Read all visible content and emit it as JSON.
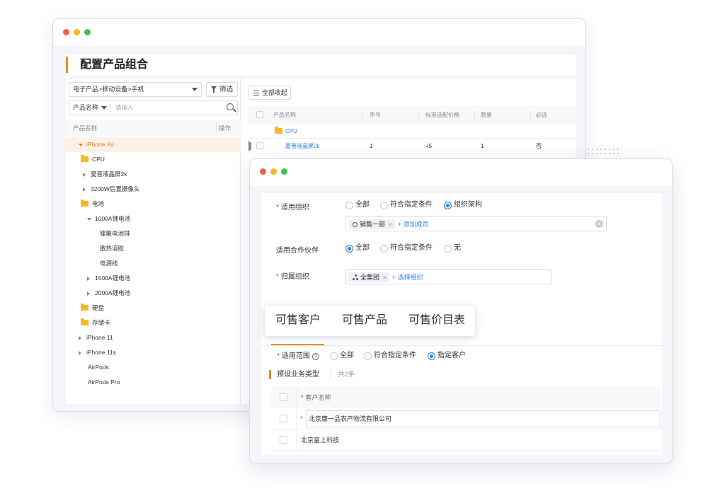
{
  "back_window": {
    "page_title": "配置产品组合",
    "category_select": "电子产品>移动设备>手机",
    "filter_button": "筛选",
    "search_field_label": "产品名称",
    "search_placeholder": "请输入",
    "tree_header": {
      "name": "产品名称",
      "action": "操作"
    },
    "tree_items": [
      {
        "label": "iPhone Xs",
        "level": 0,
        "kind": "arrow-down",
        "selected": true
      },
      {
        "label": "CPU",
        "level": 1,
        "kind": "folder"
      },
      {
        "label": "夏普液晶屏2k",
        "level": 1,
        "kind": "arrow-right"
      },
      {
        "label": "3200W后置摄像头",
        "level": 1,
        "kind": "arrow-right"
      },
      {
        "label": "电池",
        "level": 1,
        "kind": "folder"
      },
      {
        "label": "1000A锂电池",
        "level": 2,
        "kind": "arrow-down"
      },
      {
        "label": "镍聚电池排",
        "level": 3,
        "kind": "none"
      },
      {
        "label": "散热溶胶",
        "level": 3,
        "kind": "none"
      },
      {
        "label": "电源线",
        "level": 3,
        "kind": "none"
      },
      {
        "label": "1500A锂电池",
        "level": 2,
        "kind": "arrow-right"
      },
      {
        "label": "2000A锂电池",
        "level": 2,
        "kind": "arrow-right"
      },
      {
        "label": "硬盘",
        "level": 1,
        "kind": "folder"
      },
      {
        "label": "存储卡",
        "level": 1,
        "kind": "folder"
      },
      {
        "label": "iPhone 11",
        "level": 0,
        "kind": "arrow-right"
      },
      {
        "label": "iPhone 11s",
        "level": 0,
        "kind": "arrow-right"
      },
      {
        "label": "AirPods",
        "level": 0,
        "kind": "none"
      },
      {
        "label": "AirPods Pro",
        "level": 0,
        "kind": "none"
      }
    ],
    "collapse_button": "全部收起",
    "grid_headers": [
      "产品名称",
      "序号",
      "标准选配价格",
      "数量",
      "必选"
    ],
    "grid_rows": [
      {
        "name": "CPU",
        "kind": "folder",
        "seq": "",
        "price": "",
        "qty": "",
        "required": ""
      },
      {
        "name": "夏普液晶屏2k",
        "kind": "arrow-right",
        "seq": "1",
        "price": "+5",
        "qty": "1",
        "required": "否"
      }
    ]
  },
  "front_window": {
    "org_field": {
      "label": "适用组织",
      "options": [
        "全部",
        "符合指定条件",
        "组织架构"
      ],
      "selected": 2,
      "tag": "销售一部",
      "add_link": "+ 添加成员"
    },
    "partner_field": {
      "label": "适用合作伙伴",
      "options": [
        "全部",
        "符合指定条件",
        "无"
      ],
      "selected": 0
    },
    "owner_field": {
      "label": "归属组织",
      "tag": "全集团",
      "add_link": "+ 选择组织"
    },
    "tabs": [
      "可售客户",
      "可售产品",
      "可售价目表"
    ],
    "active_tab": 0,
    "scope_field": {
      "label": "适用范围",
      "options": [
        "全部",
        "符合指定条件",
        "指定客户"
      ],
      "selected": 2
    },
    "section": {
      "title": "预设业务类型",
      "count": "共2条"
    },
    "customer_table": {
      "header": "客户名称",
      "rows": [
        "北京康一品农产物流有限公司",
        "北京皇上科技"
      ]
    }
  },
  "colors": {
    "accent_orange": "#f08a24",
    "primary_blue": "#2f7cf6",
    "required_red": "#f5222d",
    "folder_yellow": "#f7b825"
  }
}
